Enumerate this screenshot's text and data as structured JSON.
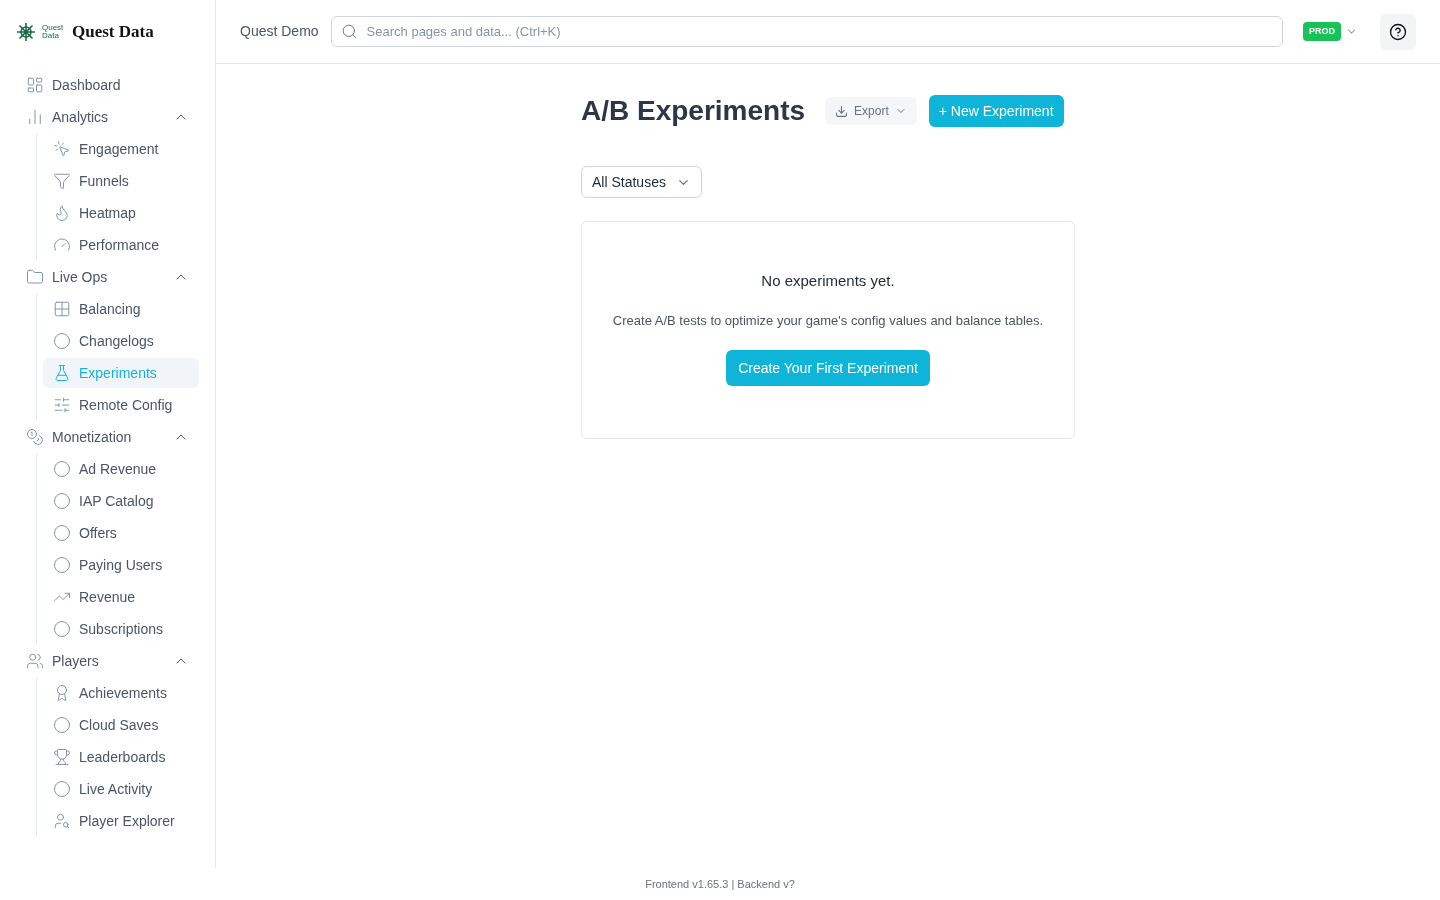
{
  "logo": {
    "mark_text": "Quest Data",
    "name": "Quest Data"
  },
  "sidebar": {
    "items": [
      {
        "label": "Dashboard",
        "selected": false
      },
      {
        "label": "Analytics",
        "selected": false,
        "expanded": true,
        "children": [
          {
            "label": "Engagement",
            "selected": false
          },
          {
            "label": "Funnels",
            "selected": false
          },
          {
            "label": "Heatmap",
            "selected": false
          },
          {
            "label": "Performance",
            "selected": false
          }
        ]
      },
      {
        "label": "Live Ops",
        "selected": false,
        "expanded": true,
        "children": [
          {
            "label": "Balancing",
            "selected": false
          },
          {
            "label": "Changelogs",
            "selected": false
          },
          {
            "label": "Experiments",
            "selected": true
          },
          {
            "label": "Remote Config",
            "selected": false
          }
        ]
      },
      {
        "label": "Monetization",
        "selected": false,
        "expanded": true,
        "children": [
          {
            "label": "Ad Revenue",
            "selected": false
          },
          {
            "label": "IAP Catalog",
            "selected": false
          },
          {
            "label": "Offers",
            "selected": false
          },
          {
            "label": "Paying Users",
            "selected": false
          },
          {
            "label": "Revenue",
            "selected": false
          },
          {
            "label": "Subscriptions",
            "selected": false
          }
        ]
      },
      {
        "label": "Players",
        "selected": false,
        "expanded": true,
        "children": [
          {
            "label": "Achievements",
            "selected": false
          },
          {
            "label": "Cloud Saves",
            "selected": false
          },
          {
            "label": "Leaderboards",
            "selected": false
          },
          {
            "label": "Live Activity",
            "selected": false
          },
          {
            "label": "Player Explorer",
            "selected": false
          }
        ]
      }
    ]
  },
  "header": {
    "project": "Quest Demo",
    "search": {
      "placeholder": "Search pages and data... (Ctrl+K)"
    },
    "environment": "PROD"
  },
  "page": {
    "title": "A/B Experiments",
    "export_button": "Export",
    "new_button": "+ New Experiment",
    "status_filter": "All Statuses",
    "empty_state": {
      "title": "No experiments yet.",
      "text": "Create A/B tests to optimize your game's config values and balance tables.",
      "button": "Create Your First Experiment"
    }
  },
  "footer": "Frontend v1.65.3 | Backend v?"
}
